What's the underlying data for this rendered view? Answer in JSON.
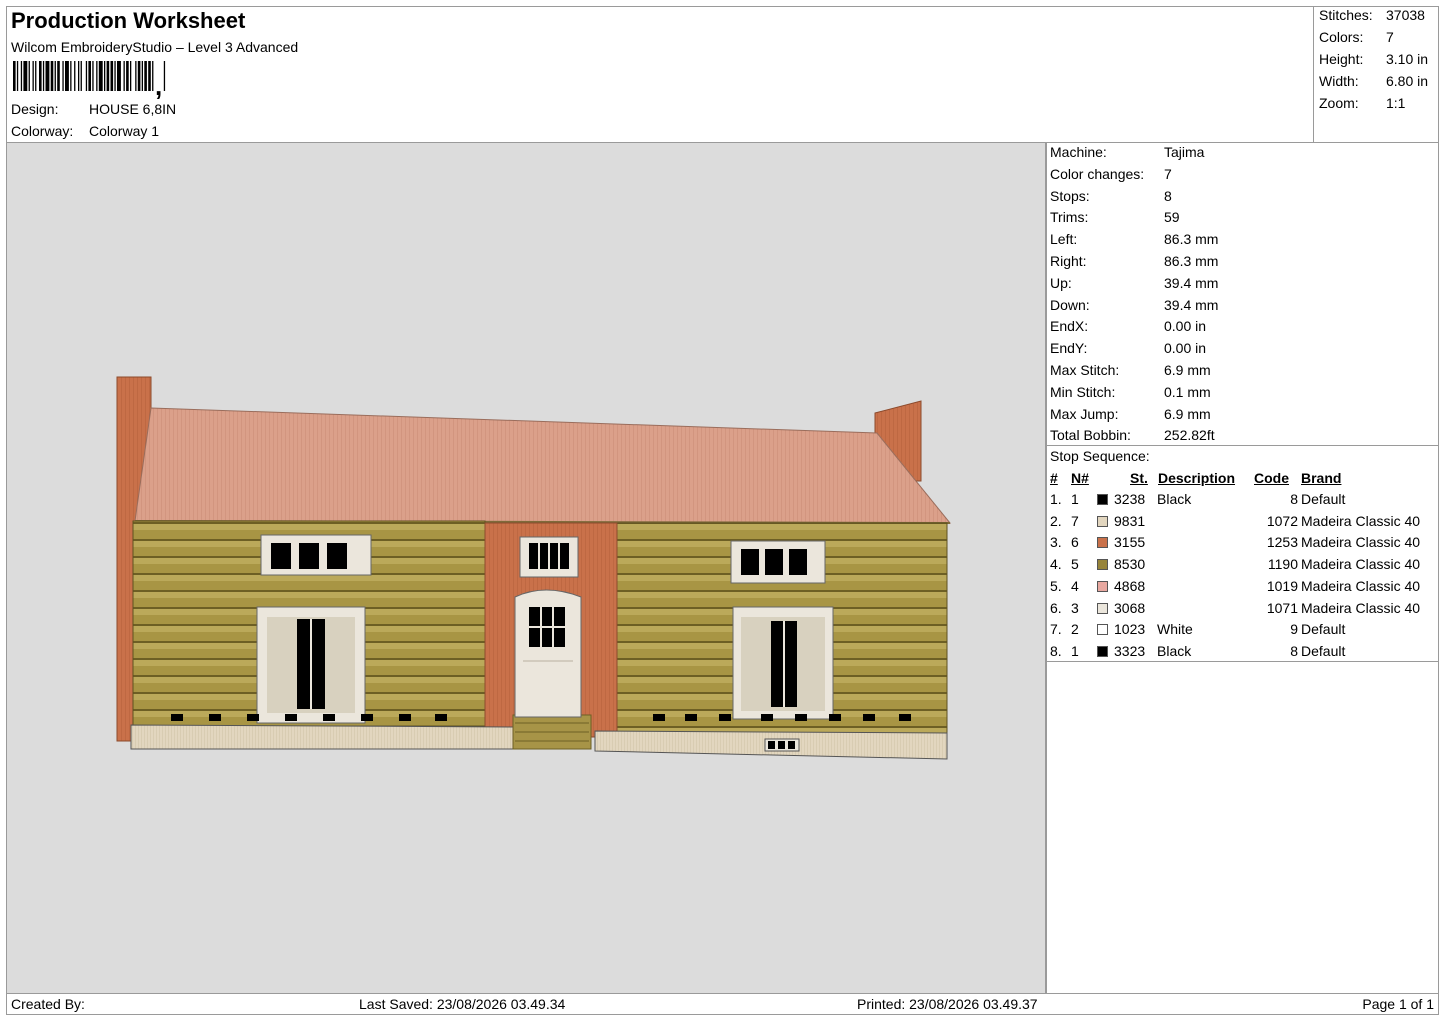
{
  "header": {
    "title": "Production Worksheet",
    "subtitle": "Wilcom EmbroideryStudio – Level 3 Advanced",
    "design_label": "Design:",
    "design_value": "HOUSE 6,8IN",
    "colorway_label": "Colorway:",
    "colorway_value": "Colorway 1"
  },
  "stats": [
    {
      "label": "Stitches:",
      "value": "37038"
    },
    {
      "label": "Colors:",
      "value": "7"
    },
    {
      "label": "Height:",
      "value": "3.10 in"
    },
    {
      "label": "Width:",
      "value": "6.80 in"
    },
    {
      "label": "Zoom:",
      "value": "1:1"
    }
  ],
  "machine_info": [
    {
      "label": "Machine:",
      "value": "Tajima"
    },
    {
      "label": "Color changes:",
      "value": "7"
    },
    {
      "label": "Stops:",
      "value": "8"
    },
    {
      "label": "Trims:",
      "value": "59"
    },
    {
      "label": "Left:",
      "value": "86.3 mm"
    },
    {
      "label": "Right:",
      "value": "86.3 mm"
    },
    {
      "label": "Up:",
      "value": "39.4 mm"
    },
    {
      "label": "Down:",
      "value": "39.4 mm"
    },
    {
      "label": "EndX:",
      "value": "0.00 in"
    },
    {
      "label": "EndY:",
      "value": "0.00 in"
    },
    {
      "label": "Max Stitch:",
      "value": "6.9 mm"
    },
    {
      "label": "Min Stitch:",
      "value": "0.1 mm"
    },
    {
      "label": "Max Jump:",
      "value": "6.9 mm"
    },
    {
      "label": "Total Bobbin:",
      "value": "252.82ft"
    }
  ],
  "stop_sequence": {
    "title": "Stop Sequence:",
    "headers": {
      "num": "#",
      "n": "N#",
      "st": "St.",
      "desc": "Description",
      "code": "Code",
      "brand": "Brand"
    },
    "rows": [
      {
        "num": "1.",
        "n": "1",
        "color": "#000000",
        "st": "3238",
        "desc": "Black",
        "code": "8",
        "brand": "Default"
      },
      {
        "num": "2.",
        "n": "7",
        "color": "#e2d6bf",
        "st": "9831",
        "desc": "",
        "code": "1072",
        "brand": "Madeira Classic 40"
      },
      {
        "num": "3.",
        "n": "6",
        "color": "#c9714a",
        "st": "3155",
        "desc": "",
        "code": "1253",
        "brand": "Madeira Classic 40"
      },
      {
        "num": "4.",
        "n": "5",
        "color": "#97843a",
        "st": "8530",
        "desc": "",
        "code": "1190",
        "brand": "Madeira Classic 40"
      },
      {
        "num": "5.",
        "n": "4",
        "color": "#e8a8a0",
        "st": "4868",
        "desc": "",
        "code": "1019",
        "brand": "Madeira Classic 40"
      },
      {
        "num": "6.",
        "n": "3",
        "color": "#ebe6dc",
        "st": "3068",
        "desc": "",
        "code": "1071",
        "brand": "Madeira Classic 40"
      },
      {
        "num": "7.",
        "n": "2",
        "color": "#ffffff",
        "st": "1023",
        "desc": "White",
        "code": "9",
        "brand": "Default"
      },
      {
        "num": "8.",
        "n": "1",
        "color": "#000000",
        "st": "3323",
        "desc": "Black",
        "code": "8",
        "brand": "Default"
      }
    ]
  },
  "footer": {
    "created": "Created By:",
    "saved": "Last Saved: 23/08/2026 03.49.34",
    "printed": "Printed: 23/08/2026 03.49.37",
    "page": "Page 1 of 1"
  },
  "design_colors": {
    "roof": "#dba08a",
    "brick": "#c9714a",
    "logs": "#97843a",
    "trim": "#ebe6dc",
    "foundation": "#e2d6bf",
    "black": "#000000",
    "background": "#dcdcdc"
  }
}
